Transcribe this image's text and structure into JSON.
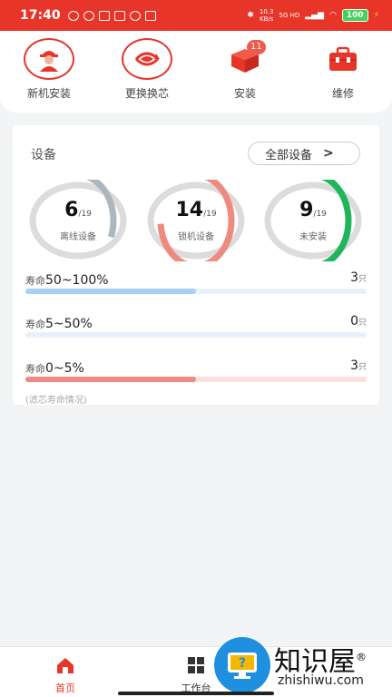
{
  "status": {
    "time": "17:40",
    "net_top": "10.3",
    "net_bottom": "KB/s",
    "net_type": "5G HD",
    "battery": "100"
  },
  "actions": [
    {
      "label": "新机安装",
      "icon": "worker-icon"
    },
    {
      "label": "更换换芯",
      "icon": "swap-icon"
    },
    {
      "label": "安装",
      "icon": "box-icon",
      "badge": "11"
    },
    {
      "label": "维修",
      "icon": "toolbox-icon"
    }
  ],
  "devices": {
    "title": "设备",
    "all_button": "全部设备",
    "rings": [
      {
        "count": "6",
        "total": "/19",
        "label": "离线设备",
        "value": 6,
        "max": 19,
        "color": "#aab7bf"
      },
      {
        "count": "14",
        "total": "/19",
        "label": "锁机设备",
        "value": 14,
        "max": 19,
        "color": "#ee8a80"
      },
      {
        "count": "9",
        "total": "/19",
        "label": "未安装",
        "value": 9,
        "max": 19,
        "color": "#1fb55a"
      }
    ],
    "life": [
      {
        "prefix": "寿命",
        "range": "50~100%",
        "count": "3",
        "unit": "只",
        "fraction": 0.5,
        "color": "#a9cff2",
        "track": "#e8f1fb"
      },
      {
        "prefix": "寿命",
        "range": "5~50%",
        "count": "0",
        "unit": "只",
        "fraction": 0.0,
        "color": "#a9cff2",
        "track": "#e8f1fb"
      },
      {
        "prefix": "寿命",
        "range": "0~5%",
        "count": "3",
        "unit": "只",
        "fraction": 0.5,
        "color": "#ee8a80",
        "track": "#fbe0dd"
      }
    ],
    "note": "(滤芯寿命情况)"
  },
  "nav": [
    {
      "label": "首页",
      "icon": "home-icon",
      "active": true
    },
    {
      "label": "工作台",
      "icon": "grid-icon",
      "active": false
    }
  ],
  "watermark": {
    "brand": "知识屋",
    "mark": "®",
    "site": "zhishiwu.com"
  },
  "colors": {
    "accent": "#e8352a"
  }
}
